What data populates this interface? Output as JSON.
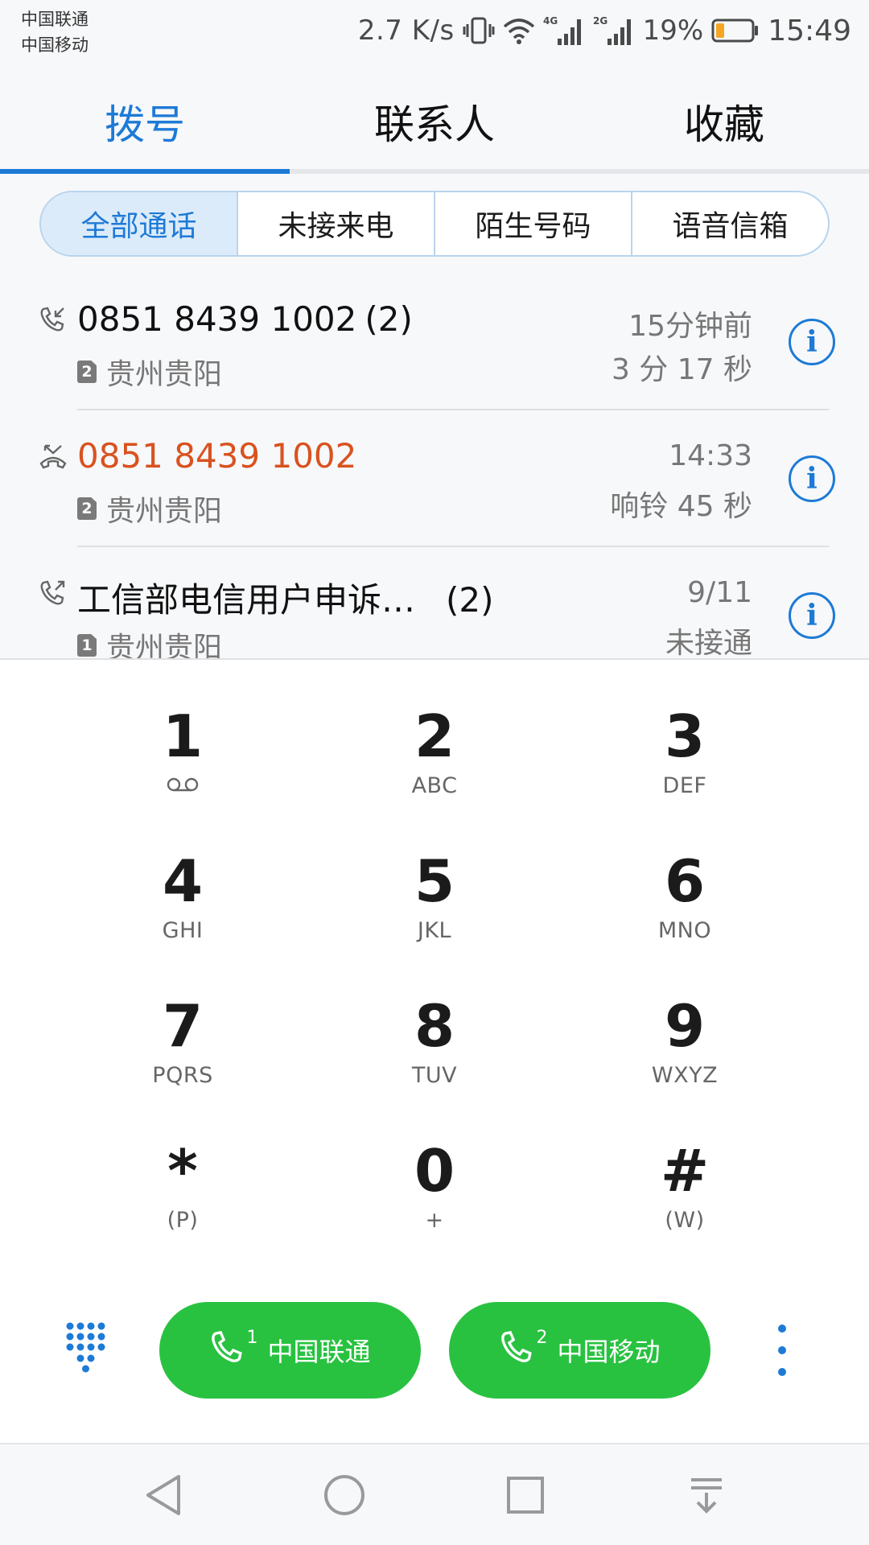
{
  "status_bar": {
    "carrier_1": "中国联通",
    "carrier_2": "中国移动",
    "net_speed": "2.7 K/s",
    "sim1_net": "4G",
    "sim2_net": "2G",
    "battery": "19%",
    "time": "15:49"
  },
  "tabs": [
    {
      "label": "拨号",
      "active": true
    },
    {
      "label": "联系人",
      "active": false
    },
    {
      "label": "收藏",
      "active": false
    }
  ],
  "filters": [
    {
      "label": "全部通话",
      "active": true
    },
    {
      "label": "未接来电",
      "active": false
    },
    {
      "label": "陌生号码",
      "active": false
    },
    {
      "label": "语音信箱",
      "active": false
    }
  ],
  "calls": [
    {
      "type": "incoming",
      "number": "0851 8439 1002",
      "count": "(2)",
      "sim": "2",
      "location": "贵州贵阳",
      "time": "15分钟前",
      "duration": "3 分 17 秒",
      "info": "i"
    },
    {
      "type": "missed",
      "number": "0851 8439 1002",
      "count": "",
      "sim": "2",
      "location": "贵州贵阳",
      "time": "14:33",
      "duration": "响铃 45 秒",
      "info": "i"
    },
    {
      "type": "outgoing",
      "number": "工信部电信用户申诉…",
      "count": "(2)",
      "sim": "1",
      "location": "贵州贵阳",
      "time": "9/11",
      "duration": "未接通",
      "info": "i"
    }
  ],
  "keys": [
    {
      "digit": "1",
      "letters": ""
    },
    {
      "digit": "2",
      "letters": "ABC"
    },
    {
      "digit": "3",
      "letters": "DEF"
    },
    {
      "digit": "4",
      "letters": "GHI"
    },
    {
      "digit": "5",
      "letters": "JKL"
    },
    {
      "digit": "6",
      "letters": "MNO"
    },
    {
      "digit": "7",
      "letters": "PQRS"
    },
    {
      "digit": "8",
      "letters": "TUV"
    },
    {
      "digit": "9",
      "letters": "WXYZ"
    },
    {
      "digit": "*",
      "letters": "(P)"
    },
    {
      "digit": "0",
      "letters": "+"
    },
    {
      "digit": "#",
      "letters": "(W)"
    }
  ],
  "call_buttons": [
    {
      "sim": "1",
      "label": "中国联通"
    },
    {
      "sim": "2",
      "label": "中国移动"
    }
  ],
  "colors": {
    "accent": "#1d7ad6",
    "missed": "#d9521f",
    "call_green": "#28c240"
  },
  "icons": {
    "voicemail": "voicemail-icon",
    "dialpad": "dialpad-grid-icon",
    "more": "more-vertical-icon",
    "back": "back-triangle-icon",
    "home": "home-circle-icon",
    "recents": "recents-square-icon",
    "notifications": "pull-down-icon"
  }
}
